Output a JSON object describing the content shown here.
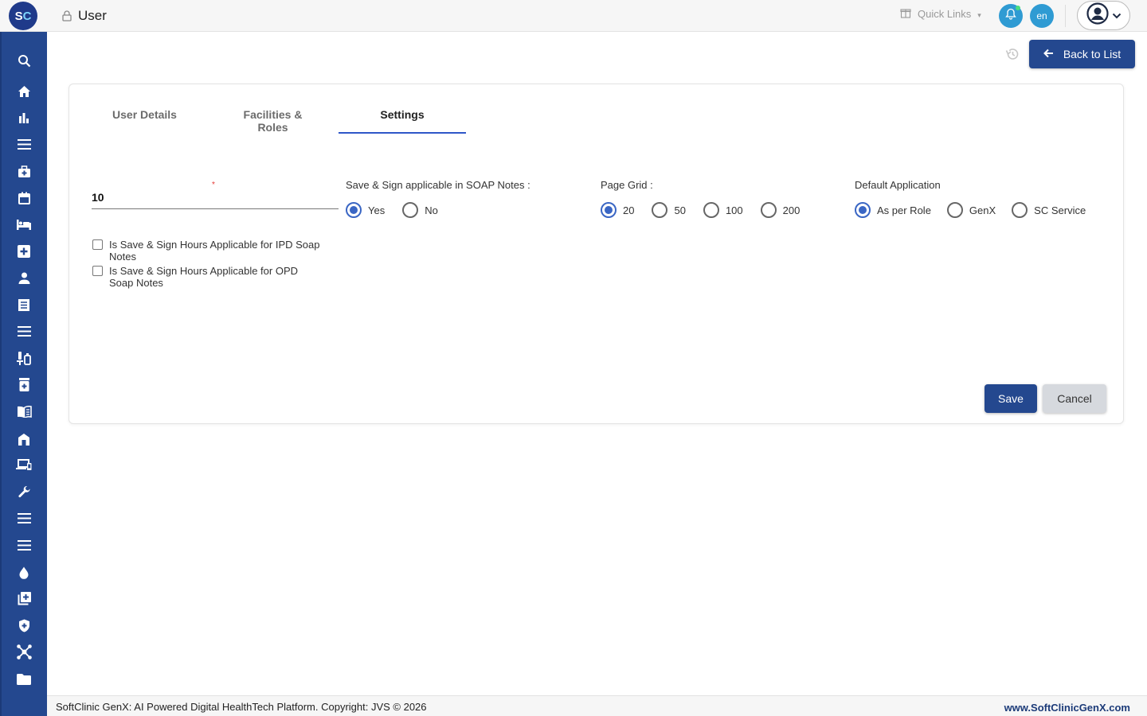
{
  "app": {
    "logo_s": "S",
    "logo_c": "C",
    "page_title": "User"
  },
  "header": {
    "quick_links": "Quick Links",
    "language": "en"
  },
  "sidebar": {
    "items": [
      {
        "icon": "search-icon"
      },
      {
        "icon": "home-icon"
      },
      {
        "icon": "bar-chart-icon"
      },
      {
        "icon": "list-icon"
      },
      {
        "icon": "medical-bag-icon"
      },
      {
        "icon": "calendar-icon"
      },
      {
        "icon": "bed-icon"
      },
      {
        "icon": "plus-box-icon"
      },
      {
        "icon": "person-icon"
      },
      {
        "icon": "receipt-icon"
      },
      {
        "icon": "list-icon"
      },
      {
        "icon": "lab-icon"
      },
      {
        "icon": "pharmacy-icon"
      },
      {
        "icon": "book-icon"
      },
      {
        "icon": "store-icon"
      },
      {
        "icon": "devices-icon"
      },
      {
        "icon": "wrench-icon"
      },
      {
        "icon": "list-icon"
      },
      {
        "icon": "list-icon"
      },
      {
        "icon": "drop-icon"
      },
      {
        "icon": "add-library-icon"
      },
      {
        "icon": "shield-icon"
      },
      {
        "icon": "hub-icon"
      },
      {
        "icon": "folder-icon"
      }
    ]
  },
  "actions": {
    "back_to_list": "Back to List"
  },
  "tabs": [
    {
      "label": "User Details",
      "active": false
    },
    {
      "label": "Facilities & Roles",
      "active": false
    },
    {
      "label": "Settings",
      "active": true
    }
  ],
  "settings": {
    "number_field_value": "10",
    "required_marker": "*",
    "soap_notes": {
      "label": "Save & Sign applicable in SOAP Notes :",
      "options": [
        "Yes",
        "No"
      ],
      "selected": "Yes"
    },
    "page_grid": {
      "label": "Page Grid :",
      "options": [
        "20",
        "50",
        "100",
        "200"
      ],
      "selected": "20"
    },
    "default_application": {
      "label": "Default Application",
      "options": [
        "As per Role",
        "GenX",
        "SC Service"
      ],
      "selected": "As per Role"
    },
    "checkboxes": [
      {
        "label": "Is Save & Sign Hours Applicable for IPD Soap Notes",
        "checked": false
      },
      {
        "label": "Is Save & Sign Hours Applicable for OPD Soap Notes",
        "checked": false
      }
    ],
    "save_label": "Save",
    "cancel_label": "Cancel"
  },
  "footer": {
    "copyright": "SoftClinic GenX: AI Powered Digital HealthTech Platform. Copyright: JVS © 2026",
    "website": "www.SoftClinicGenX.com"
  },
  "colors": {
    "primary": "#24488f",
    "accent_blue": "#2f9bd3",
    "radio_selected": "#3a66c4",
    "tab_underline": "#2f57c8"
  }
}
